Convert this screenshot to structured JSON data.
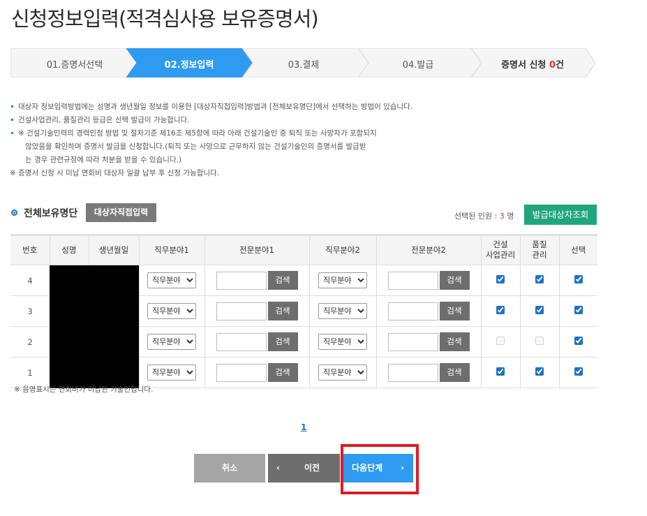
{
  "page_title": "신청정보입력(적격심사용 보유증명서)",
  "steps": [
    {
      "label": "01.증명서선택",
      "active": false
    },
    {
      "label": "02.정보입력",
      "active": true
    },
    {
      "label": "03.결제",
      "active": false
    },
    {
      "label": "04.발급",
      "active": false
    }
  ],
  "cert_count": {
    "prefix": "증명서 신청 ",
    "count": "0",
    "suffix": "건"
  },
  "notes": [
    "대상자 정보입력방법에는 성명과 생년월일 정보를 이용한 [대상자직접입력]방법과 [전체보유명단]에서 선택하는 방법이 있습니다.",
    "건설사업관리, 품질관리 등급은 선택 발급이 가능합니다.",
    "※ 건설기술인력의 경력인정 방법 및 절차기준 제16조 제5항에 따라 아래 건설기술인 중 퇴직 또는 사망자가 포함되지",
    "않았음을 확인하며 증명서 발급을 신청합니다.(퇴직 또는 사망으로 근무하지 않는 건설기술인의 증명서를 발급받",
    "는 경우 관련규정에 따라 처분을 받을 수 있습니다.)",
    "※ 증명서 신청 시 미납 연회비 대상자 일괄 납부 후 신청 가능합니다."
  ],
  "section": {
    "title": "전체보유명단",
    "direct_input_button": "대상자직접입력",
    "selected_label": "선택된 인원 : ",
    "selected_count": "3",
    "selected_unit": " 명",
    "issue_button": "발급대상자조회"
  },
  "table": {
    "headers": [
      "번호",
      "성명",
      "생년월일",
      "직무분야1",
      "전문분야1",
      "직무분야2",
      "전문분야2",
      "건설\n사업관리",
      "품질\n관리",
      "선택"
    ],
    "select_placeholder": "직무분야",
    "search_label": "검색",
    "rows": [
      {
        "num": "4",
        "cm": true,
        "cm_enabled": true,
        "qm": true,
        "qm_enabled": true,
        "sel": true
      },
      {
        "num": "3",
        "cm": true,
        "cm_enabled": true,
        "qm": true,
        "qm_enabled": true,
        "sel": true
      },
      {
        "num": "2",
        "cm": false,
        "cm_enabled": false,
        "qm": false,
        "qm_enabled": false,
        "sel": true
      },
      {
        "num": "1",
        "cm": true,
        "cm_enabled": true,
        "qm": true,
        "qm_enabled": true,
        "sel": true
      }
    ]
  },
  "shading_note": "※ 음영표시는 연회비가 미납된 기술인입니다.",
  "pagination": {
    "current": "1"
  },
  "buttons": {
    "cancel": "취소",
    "prev": "이전",
    "next": "다음단계",
    "prev_arrow": "‹",
    "next_arrow": "›"
  },
  "colors": {
    "active_step": "#2e9bf0",
    "issue_button": "#20a67c",
    "highlight": "#e01b24"
  }
}
